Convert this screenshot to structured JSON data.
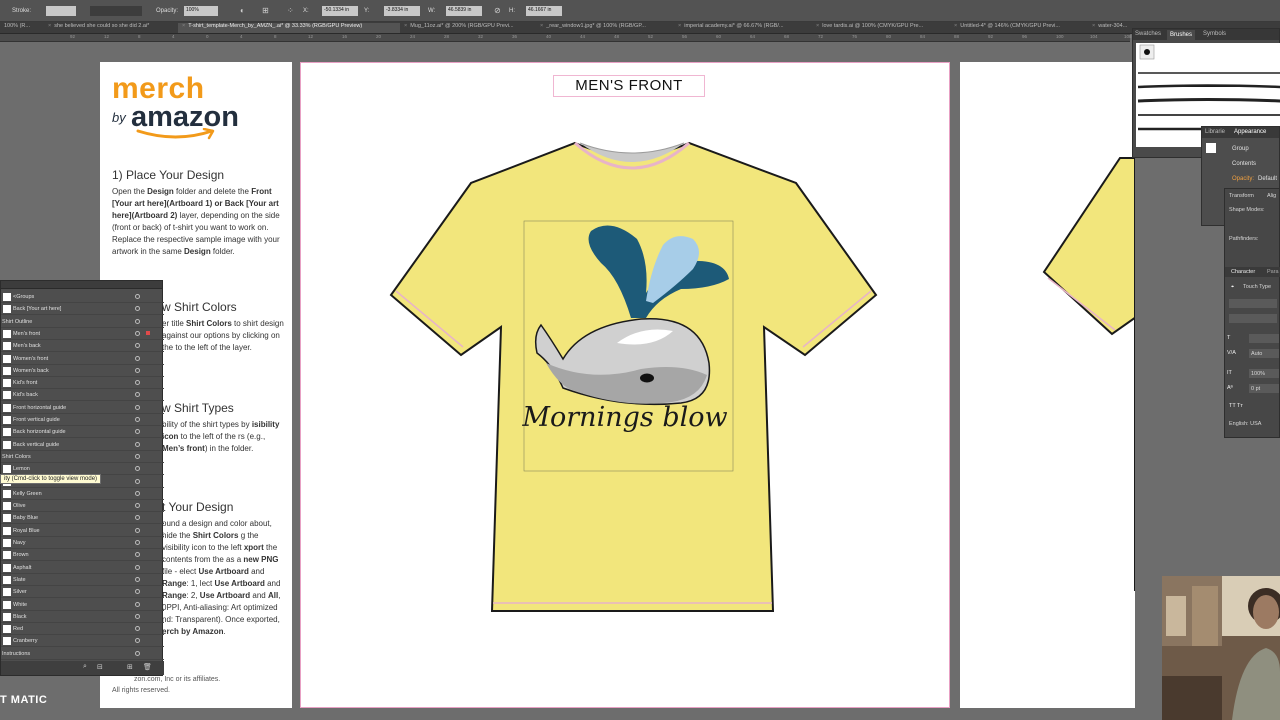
{
  "control_bar": {
    "stroke_label": "Stroke:",
    "opacity_label": "Opacity:",
    "opacity_value": "100%",
    "x_label": "X:",
    "x_value": "-50.1334 in",
    "y_label": "Y:",
    "y_value": "-3.8334 in",
    "w_label": "W:",
    "w_value": "46.5839 in",
    "h_label": "H:",
    "h_value": "46.1667 in"
  },
  "tabs": [
    {
      "label": "100% (R..."
    },
    {
      "label": "she believed she could so she did 2.ai*"
    },
    {
      "label": "T-shirt_template-Merch_by_AMZN_.ai* @ 33.33% (RGB/GPU Preview)"
    },
    {
      "label": "Mug_11oz.ai* @ 200% (RGB/GPU Previ..."
    },
    {
      "label": "_rear_window1.jpg* @ 100% (RGB/GP..."
    },
    {
      "label": "imperial academy.ai* @ 66.67% (RGB/..."
    },
    {
      "label": "love tardis.ai @ 100% (CMYK/GPU Pre..."
    },
    {
      "label": "Untitled-4* @ 146% (CMYK/GPU Previ..."
    },
    {
      "label": "water-304..."
    }
  ],
  "ruler": [
    "92",
    "12",
    "8",
    "4",
    "0",
    "4",
    "8",
    "12",
    "16",
    "20",
    "24",
    "28",
    "32",
    "36",
    "40",
    "44",
    "48",
    "52",
    "56",
    "60",
    "64",
    "68",
    "72",
    "76",
    "80",
    "84",
    "88",
    "92",
    "96",
    "100",
    "104",
    "108"
  ],
  "info_panel": {
    "logo_merch": "merch",
    "logo_by": "by",
    "logo_amazon": "amazon",
    "step1_title": "1) Place Your Design",
    "step1_text_a": "Open the ",
    "step1_text_b": "Design",
    "step1_text_c": " folder and delete the ",
    "step1_text_d": "Front [Your art here](Artboard 1) or  Back [Your art here](Artboard 2)",
    "step1_text_e": " layer, depending on the side (front or back) of t-shirt you want to work on. Replace the respective sample image with your artwork in the same ",
    "step1_text_f": "Design",
    "step1_text_g": " folder.",
    "step2_title": "w Shirt Colors",
    "step2_text_a": "er title ",
    "step2_text_b": "Shirt Colors",
    "step2_text_c": " to shirt design against our options by clicking on the to the left of the layer.",
    "step3_title": "w Shirt Types",
    "step3_text_a": "bility of the shirt types by ",
    "step3_text_b": "isibility icon",
    "step3_text_c": " to the left of the rs (e.g., ",
    "step3_text_d": "Men’s front",
    "step3_text_e": ") in the folder.",
    "step4_title": "t Your Design",
    "step4_text_a": "ound a design and color about, hide the ",
    "step4_text_b": "Shirt Colors",
    "step4_text_c": " g the visibility icon to the left ",
    "step4_text_d": "xport",
    "step4_text_e": " the contents from the as a ",
    "step4_text_f": "new PNG",
    "step4_text_g": " file - elect ",
    "step4_text_h": "Use Artboard",
    "step4_text_i": " and ",
    "step4_text_j": "Range",
    "step4_text_k": ": 1, lect ",
    "step4_text_l": "Use Artboard",
    "step4_text_m": " and ",
    "step4_text_n": "Range",
    "step4_text_o": ": 2, ",
    "step4_text_p": "Use Artboard",
    "step4_text_q": " and ",
    "step4_text_r": "All",
    "step4_text_s": ", 0PPI, Anti-aliasing: Art optimized nd: Transparent). Once exported, ",
    "step4_text_t": "erch by Amazon",
    "step4_text_u": ".",
    "footer_a": "zon.com, Inc or its affiliates.",
    "footer_b": "All rights reserved."
  },
  "artboard": {
    "title": "MEN'S FRONT",
    "design_text": "Mornings blow",
    "shirt_color": "#f2e67c",
    "whale_body_color": "#d0d0d0",
    "spout_dark_color": "#1d5a78",
    "spout_light_color": "#a7cde8"
  },
  "layers_panel": {
    "rows": [
      {
        "label": "<Groups",
        "type": "item"
      },
      {
        "label": "Back [Your art here]",
        "type": "item"
      },
      {
        "label": "Shirt Outline",
        "type": "group"
      },
      {
        "label": "Men's front",
        "type": "item"
      },
      {
        "label": "Men's back",
        "type": "item"
      },
      {
        "label": "Women's front",
        "type": "item"
      },
      {
        "label": "Women's back",
        "type": "item"
      },
      {
        "label": "Kid's front",
        "type": "item"
      },
      {
        "label": "Kid's back",
        "type": "item"
      },
      {
        "label": "Front horizontal guide",
        "type": "item"
      },
      {
        "label": "Front vertical guide",
        "type": "item"
      },
      {
        "label": "Back horizontal guide",
        "type": "item"
      },
      {
        "label": "Back vertical guide",
        "type": "item"
      },
      {
        "label": "Shirt Colors",
        "type": "group"
      },
      {
        "label": "Lemon",
        "type": "item"
      },
      {
        "label": "",
        "type": "item"
      },
      {
        "label": "Kelly Green",
        "type": "item"
      },
      {
        "label": "Olive",
        "type": "item"
      },
      {
        "label": "Baby Blue",
        "type": "item"
      },
      {
        "label": "Royal Blue",
        "type": "item"
      },
      {
        "label": "Navy",
        "type": "item"
      },
      {
        "label": "Brown",
        "type": "item"
      },
      {
        "label": "Asphalt",
        "type": "item"
      },
      {
        "label": "Slate",
        "type": "item"
      },
      {
        "label": "Silver",
        "type": "item"
      },
      {
        "label": "White",
        "type": "item"
      },
      {
        "label": "Black",
        "type": "item"
      },
      {
        "label": "Red",
        "type": "item"
      },
      {
        "label": "Cranberry",
        "type": "item"
      },
      {
        "label": "Instructions",
        "type": "group"
      }
    ],
    "tooltip": "ity (Cmd-click to toggle view mode)"
  },
  "brushes_panel": {
    "tab_swatches": "Swatches",
    "tab_brushes": "Brushes",
    "tab_symbols": "Symbols"
  },
  "appearance_panel": {
    "tab_libraries": "Librarie",
    "tab_appearance": "Appearance",
    "group_label": "Group",
    "contents_label": "Contents",
    "opacity_label": "Opacity:",
    "opacity_value": "Default"
  },
  "side_panel": {
    "transform": "Transform",
    "align": "Alig",
    "shape_modes": "Shape Modes:",
    "pathfinders": "Pathfinders:",
    "character": "Character",
    "paragraph": "Para",
    "touch_type": "Touch Type",
    "auto": "Auto",
    "scale": "100%",
    "tracking": "0 pt",
    "language": "English: USA"
  },
  "watermark": "T MATIC"
}
